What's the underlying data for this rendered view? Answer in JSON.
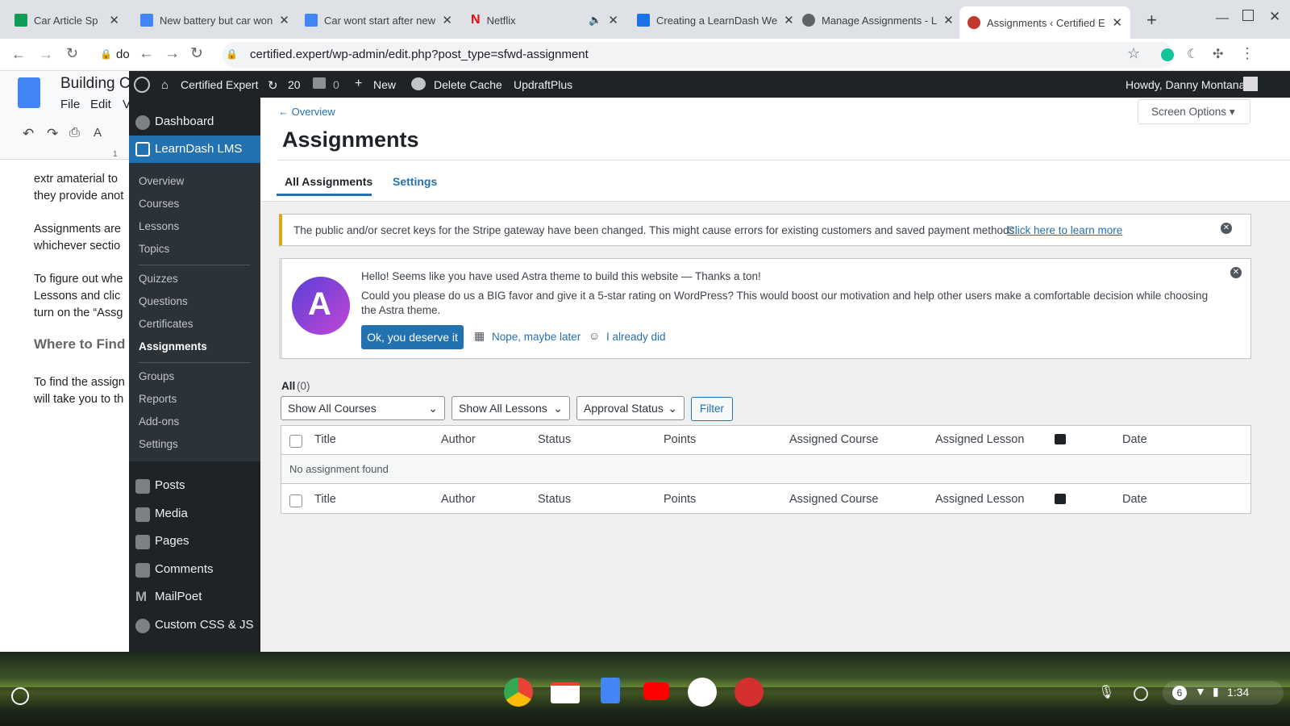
{
  "browser_tabs": [
    {
      "title": "Car Article Sp",
      "color": "#0f9d58"
    },
    {
      "title": "New battery but car won",
      "color": "#4285f4"
    },
    {
      "title": "Car wont start after new",
      "color": "#4285f4"
    },
    {
      "title": "Netflix",
      "color": "#e50914"
    },
    {
      "title": "Creating a LearnDash We",
      "color": "#1a73e8"
    },
    {
      "title": "Manage Assignments - L",
      "color": "#5f6368"
    },
    {
      "title": "Assignments ‹ Certified E",
      "color": "#c0392b"
    }
  ],
  "address": {
    "url": "certified.expert/wp-admin/edit.php?post_type=sfwd-assignment",
    "bg_url": "do"
  },
  "doc": {
    "title": "Building C",
    "menu": [
      "File",
      "Edit",
      "V"
    ],
    "ruler_mark": "1",
    "lines": [
      "extr amaterial to",
      "they provide anot",
      "Assignments are",
      "whichever sectio",
      "To figure out whe",
      "Lessons and clic",
      "turn on the “Assg",
      "Where to Find",
      "To find the assign",
      "will take you to th"
    ]
  },
  "adminbar": {
    "site": "Certified Expert",
    "updates": "20",
    "comments": "0",
    "new": "New",
    "cache": "Delete Cache",
    "updraft": "UpdraftPlus",
    "howdy": "Howdy, Danny Montana"
  },
  "sidebar": {
    "dashboard": "Dashboard",
    "learndash": "LearnDash LMS",
    "sub": [
      "Overview",
      "Courses",
      "Lessons",
      "Topics",
      "Quizzes",
      "Questions",
      "Certificates",
      "Assignments",
      "Groups",
      "Reports",
      "Add-ons",
      "Settings"
    ],
    "main": [
      "Posts",
      "Media",
      "Pages",
      "Comments",
      "MailPoet",
      "Custom CSS & JS"
    ]
  },
  "content": {
    "back_link": "← Overview",
    "title": "Assignments",
    "screen_options": "Screen Options",
    "tabs": [
      "All Assignments",
      "Settings"
    ],
    "stripe_notice": "The public and/or secret keys for the Stripe gateway have been changed. This might cause errors for existing customers and saved payment methods.",
    "stripe_link": "Click here to learn more",
    "astra_hello": "Hello! Seems like you have used Astra theme to build this website — Thanks a ton!",
    "astra_ask": "Could you please do us a BIG favor and give it a 5-star rating on WordPress? This would boost our motivation and help other users make a comfortable decision while choosing the Astra theme.",
    "astra_ok": "Ok, you deserve it",
    "astra_later": "Nope, maybe later",
    "astra_did": "I already did",
    "all_label": "All",
    "all_count": "(0)",
    "filters": [
      "Show All Courses",
      "Show All Lessons",
      "Approval Status"
    ],
    "filter_button": "Filter",
    "columns": [
      "Title",
      "Author",
      "Status",
      "Points",
      "Assigned Course",
      "Assigned Lesson",
      "Date"
    ],
    "empty": "No assignment found"
  },
  "taskbar": {
    "notif": "6",
    "time": "1:34"
  }
}
